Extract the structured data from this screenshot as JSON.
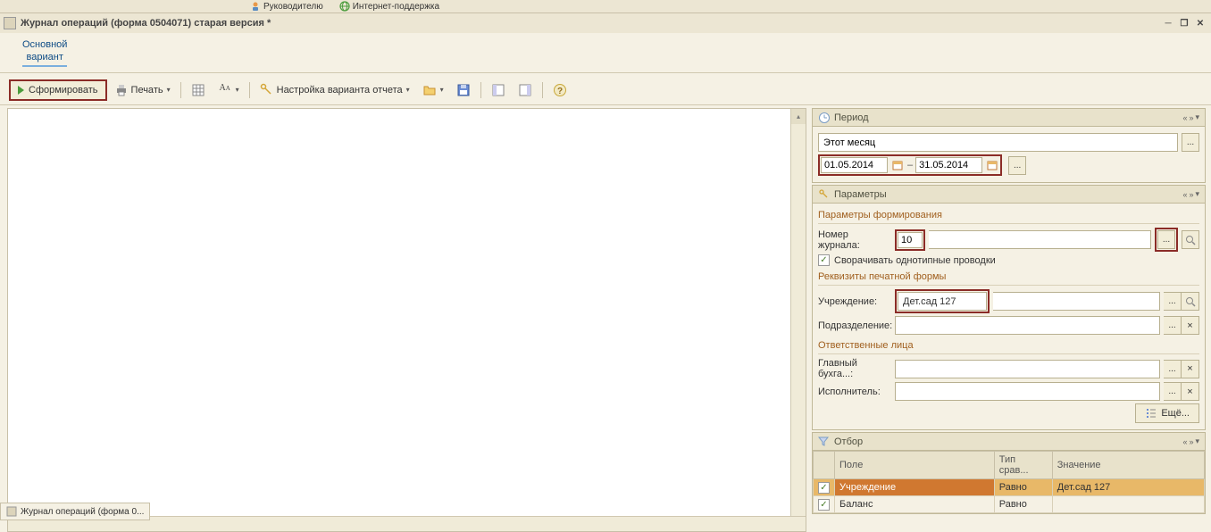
{
  "topmenu": {
    "ruk": "Руководителю",
    "support": "Интернет-поддержка"
  },
  "title": "Журнал операций (форма 0504071) старая версия *",
  "variant": {
    "label": "Основной\nвариант"
  },
  "toolbar": {
    "generate": "Сформировать",
    "print": "Печать",
    "settings": "Настройка варианта отчета"
  },
  "period": {
    "header": "Период",
    "preset": "Этот месяц",
    "from": "01.05.2014",
    "to": "31.05.2014"
  },
  "params": {
    "header": "Параметры",
    "section_form": "Параметры формирования",
    "journal_num_label": "Номер журнала:",
    "journal_num": "10",
    "collapse_label": "Сворачивать однотипные проводки",
    "section_req": "Реквизиты печатной формы",
    "org_label": "Учреждение:",
    "org_value": "Дет.сад 127",
    "subdiv_label": "Подразделение:",
    "section_resp": "Ответственные лица",
    "chief_label": "Главный бухга...:",
    "executor_label": "Исполнитель:",
    "more": "Ещё..."
  },
  "filter": {
    "header": "Отбор",
    "col_field": "Поле",
    "col_cmp": "Тип срав...",
    "col_val": "Значение",
    "rows": [
      {
        "field": "Учреждение",
        "cmp": "Равно",
        "val": "Дет.сад 127",
        "checked": true,
        "selected": true
      },
      {
        "field": "Баланс",
        "cmp": "Равно",
        "val": "",
        "checked": true,
        "selected": false
      }
    ]
  },
  "footer_tab": "Журнал операций (форма 0..."
}
